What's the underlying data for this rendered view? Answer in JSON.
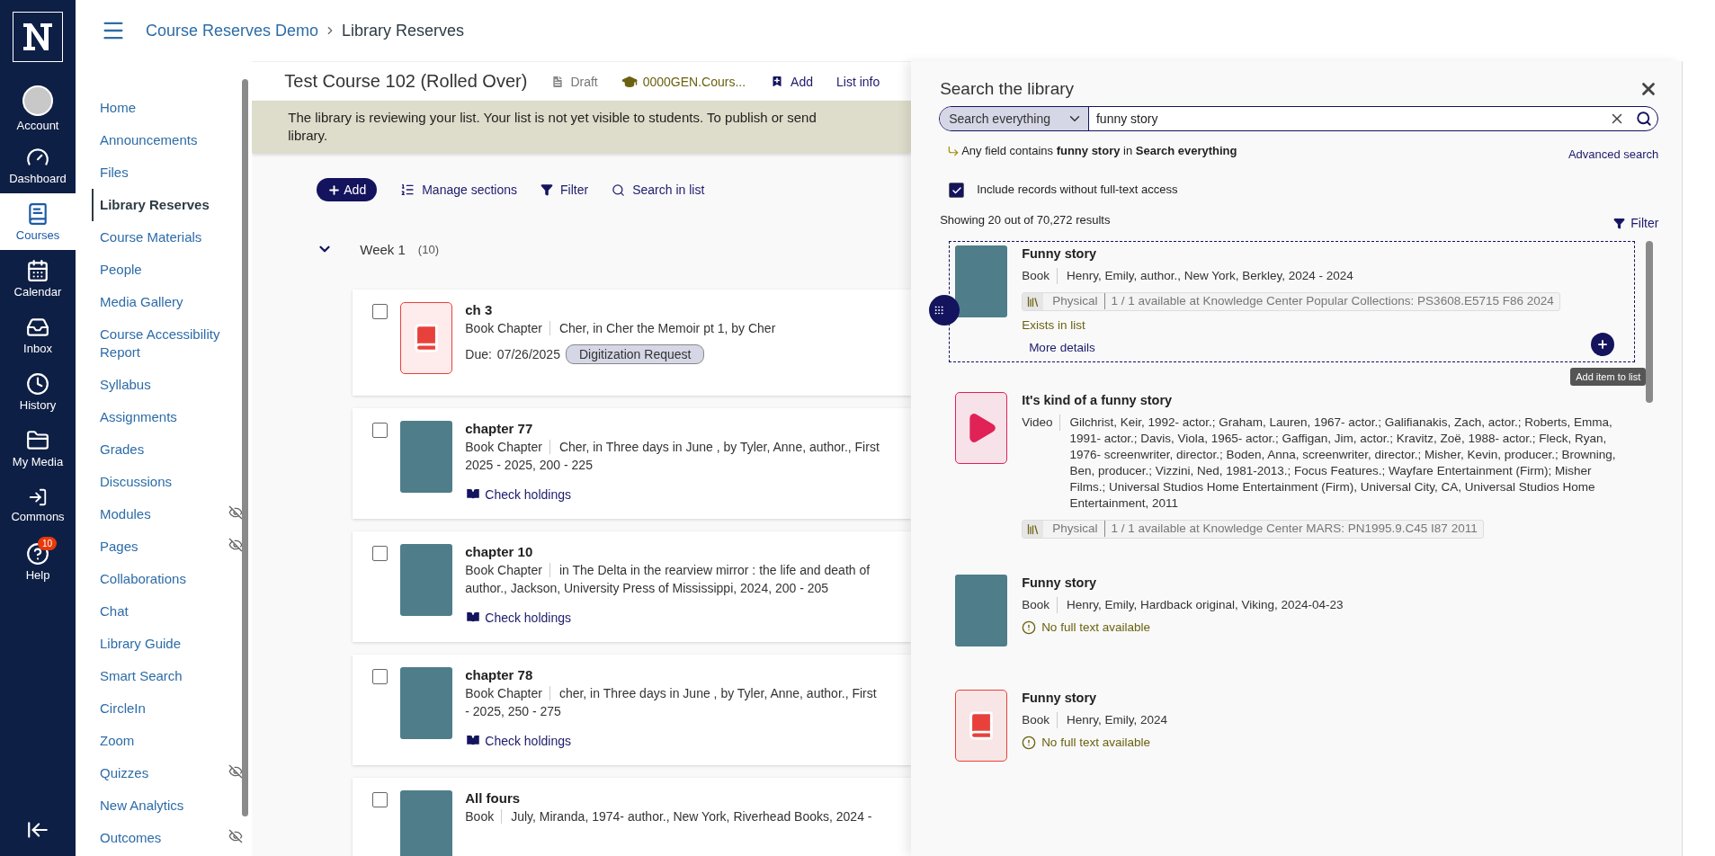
{
  "global_nav": {
    "items": [
      {
        "label": "Account",
        "selected": false
      },
      {
        "label": "Dashboard",
        "selected": false
      },
      {
        "label": "Courses",
        "selected": true
      },
      {
        "label": "Calendar",
        "selected": false
      },
      {
        "label": "Inbox",
        "selected": false
      },
      {
        "label": "History",
        "selected": false
      },
      {
        "label": "My Media",
        "selected": false
      },
      {
        "label": "Commons",
        "selected": false
      },
      {
        "label": "Help",
        "selected": false,
        "badge": "10"
      }
    ]
  },
  "breadcrumb": [
    "Course Reserves Demo",
    "Library Reserves"
  ],
  "course_nav": [
    {
      "label": "Home",
      "selected": false,
      "hidden": false
    },
    {
      "label": "Announcements",
      "selected": false,
      "hidden": false
    },
    {
      "label": "Files",
      "selected": false,
      "hidden": false
    },
    {
      "label": "Library Reserves",
      "selected": true,
      "hidden": false
    },
    {
      "label": "Course Materials",
      "selected": false,
      "hidden": false
    },
    {
      "label": "People",
      "selected": false,
      "hidden": false
    },
    {
      "label": "Media Gallery",
      "selected": false,
      "hidden": false
    },
    {
      "label": "Course Accessibility Report",
      "selected": false,
      "hidden": false
    },
    {
      "label": "Syllabus",
      "selected": false,
      "hidden": false
    },
    {
      "label": "Assignments",
      "selected": false,
      "hidden": false
    },
    {
      "label": "Grades",
      "selected": false,
      "hidden": false
    },
    {
      "label": "Discussions",
      "selected": false,
      "hidden": false
    },
    {
      "label": "Modules",
      "selected": false,
      "hidden": true
    },
    {
      "label": "Pages",
      "selected": false,
      "hidden": true
    },
    {
      "label": "Collaborations",
      "selected": false,
      "hidden": false
    },
    {
      "label": "Chat",
      "selected": false,
      "hidden": false
    },
    {
      "label": "Library Guide",
      "selected": false,
      "hidden": false
    },
    {
      "label": "Smart Search",
      "selected": false,
      "hidden": false
    },
    {
      "label": "CircleIn",
      "selected": false,
      "hidden": false
    },
    {
      "label": "Zoom",
      "selected": false,
      "hidden": false
    },
    {
      "label": "Quizzes",
      "selected": false,
      "hidden": true
    },
    {
      "label": "New Analytics",
      "selected": false,
      "hidden": false
    },
    {
      "label": "Outcomes",
      "selected": false,
      "hidden": true
    }
  ],
  "list_header": {
    "title": "Test Course 102 (Rolled Over)",
    "status": "Draft",
    "course": "0000GEN.Cours...",
    "add": "Add",
    "list_info": "List info"
  },
  "banner": [
    "The library is reviewing your list. Your list is not yet visible to students. To publish or send",
    "library."
  ],
  "toolbar": {
    "add": "Add",
    "manage": "Manage sections",
    "filter": "Filter",
    "search": "Search in list"
  },
  "section": {
    "title": "Week 1",
    "count": "(10)",
    "expanded": true
  },
  "items": [
    {
      "title": "ch 3",
      "kind": "book",
      "checked": false,
      "type": "Book Chapter",
      "details": [
        "Cher, in Cher the Memoir pt 1, by Cher"
      ],
      "due_label": "Due:",
      "due": "07/26/2025",
      "tag": "Digitization Request"
    },
    {
      "title": "chapter 77",
      "kind": "image",
      "checked": false,
      "type": "Book Chapter",
      "details": [
        "Cher, in Three days in June , by Tyler, Anne, author., First",
        "2025 - 2025, 200 - 225"
      ],
      "link": "Check holdings"
    },
    {
      "title": "chapter 10",
      "kind": "image",
      "checked": false,
      "type": "Book Chapter",
      "details": [
        "in The Delta in the rearview mirror : the life and death of",
        "author., Jackson, University Press of Mississippi, 2024, 200 - 205"
      ],
      "link": "Check holdings"
    },
    {
      "title": "chapter 78",
      "kind": "image",
      "checked": false,
      "type": "Book Chapter",
      "details": [
        "cher, in Three days in June , by Tyler, Anne, author., First",
        "- 2025, 250 - 275"
      ],
      "link": "Check holdings"
    },
    {
      "title": "All fours",
      "kind": "image",
      "checked": false,
      "type": "Book",
      "details": [
        "July, Miranda, 1974- author., New York, Riverhead Books, 2024 -"
      ]
    }
  ],
  "panel": {
    "title": "Search the library",
    "scope": "Search everything",
    "query": "funny story",
    "summary": "Any field contains **funny story** in **Search everything**",
    "advanced": "Advanced search",
    "include_label": "Include records without full-text access",
    "include_checked": true,
    "count": "Showing 20 out of 70,272 results",
    "filter": "Filter",
    "tooltip": "Add item to list",
    "results": [
      {
        "title": "Funny story",
        "kind": "image",
        "selected": true,
        "type": "Book",
        "details": "Henry, Emily, author., New York, Berkley, 2024 - 2024",
        "holding": {
          "label": "Physical",
          "text": "1 / 1 available at Knowledge Center Popular Collections: PS3608.E5715 F86 2024"
        },
        "status": "Exists in list",
        "more": "More details"
      },
      {
        "title": "It's kind of a funny story",
        "kind": "video",
        "selected": false,
        "type": "Video",
        "details": "Gilchrist, Keir, 1992- actor.; Graham, Lauren, 1967- actor.; Galifianakis, Zach, actor.; Roberts, Emma, 1991- actor.; Davis, Viola, 1965- actor.; Gaffigan, Jim, actor.; Kravitz, Zoë, 1988- actor.; Fleck, Ryan, 1976- screenwriter, director.; Boden, Anna, screenwriter, director.; Misher, Kevin, producer.; Browning, Ben, producer.; Vizzini, Ned, 1981-2013.; Focus Features.; Wayfare Entertainment (Firm); Misher Films.; Universal Studios Home Entertainment (Firm), Universal City, CA, Universal Studios Home Entertainment, 2011",
        "holding": {
          "label": "Physical",
          "text": "1 / 1 available at Knowledge Center MARS: PN1995.9.C45 I87 2011"
        }
      },
      {
        "title": "Funny story",
        "kind": "image",
        "selected": false,
        "type": "Book",
        "details": "Henry, Emily, Hardback original, Viking, 2024-04-23",
        "notice": "No full text available"
      },
      {
        "title": "Funny story",
        "kind": "book",
        "selected": false,
        "type": "Book",
        "details": "Henry, Emily, 2024",
        "notice": "No full text available"
      }
    ]
  }
}
